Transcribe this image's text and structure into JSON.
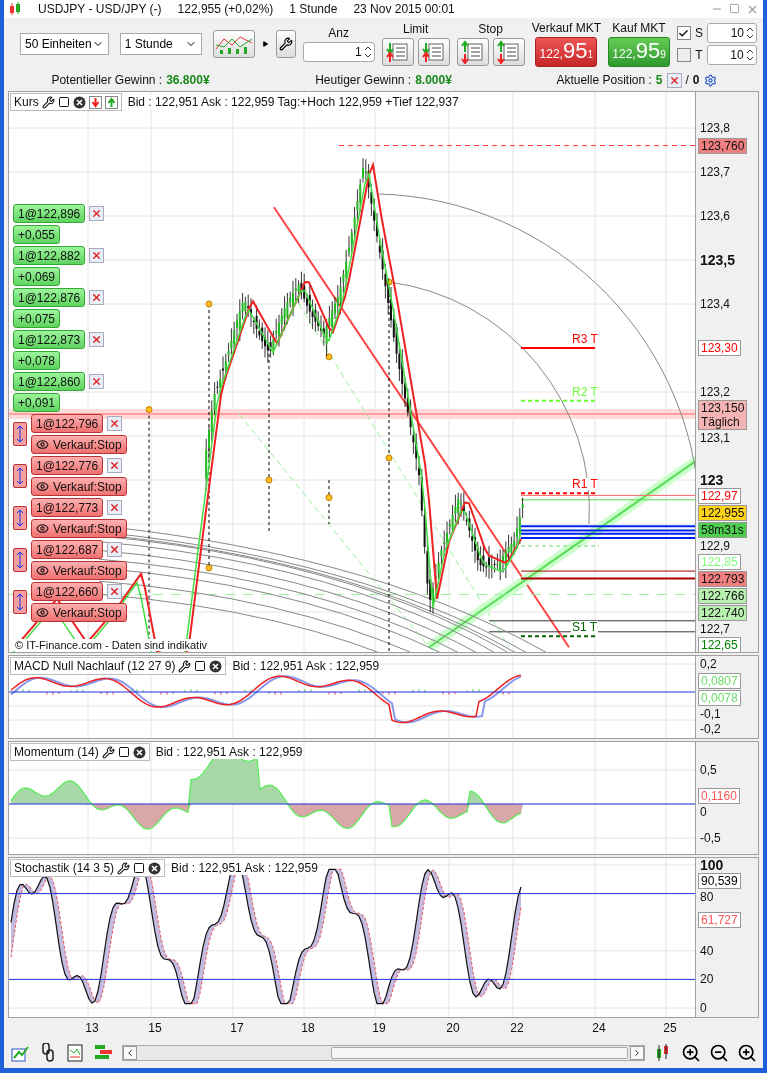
{
  "window": {
    "title": "USDJPY - USD/JPY (-)",
    "quote": "122,955 (+0,02%)",
    "period": "1 Stunde",
    "datetime": "23 Nov 2015 00:01"
  },
  "toolbar": {
    "units": "50 Einheiten",
    "timeframe": "1 Stunde",
    "quantity": {
      "label": "Anz",
      "value": "1"
    },
    "limit_label": "Limit",
    "stop_label": "Stop",
    "trade_buttons": [
      {
        "kind": "sell",
        "label": "Verkauf MKT",
        "small": "122,",
        "big": "95",
        "pip": "1"
      },
      {
        "kind": "buy",
        "label": "Kauf MKT",
        "small": "122,",
        "big": "95",
        "pip": "9"
      }
    ],
    "options": [
      {
        "label": "S",
        "checked": true,
        "value": "10"
      },
      {
        "label": "T",
        "checked": false,
        "value": "10"
      }
    ]
  },
  "summary": [
    {
      "label": "Potentieller Gewinn :",
      "value": "36.800¥"
    },
    {
      "label": "Heutiger Gewinn :",
      "value": "8.000¥"
    }
  ],
  "position": {
    "label": "Aktuelle Position :",
    "long": "5",
    "separator": "/",
    "short": "0"
  },
  "price_panel": {
    "title": "Kurs",
    "quote": "Bid : 122,951 Ask : 122,959 Tag:+Hoch 122,959 +Tief 122,937",
    "copyright": "© IT-Finance.com - Daten sind indikativ",
    "axis": [
      {
        "label": "123,8",
        "kind": "tick"
      },
      {
        "label": "123,760",
        "kind": "filled",
        "color": "#f08080"
      },
      {
        "label": "123,7",
        "kind": "tick"
      },
      {
        "label": "123,6",
        "kind": "tick"
      },
      {
        "label": "123,5",
        "kind": "major"
      },
      {
        "label": "123,4",
        "kind": "tick"
      },
      {
        "label": "123,30",
        "kind": "outlined",
        "color": "#ff0000"
      },
      {
        "label": "123,2",
        "kind": "tick"
      },
      {
        "label": "123,150",
        "sub": "Täglich",
        "kind": "filled",
        "color": "#f4b4b4"
      },
      {
        "label": "123,1",
        "kind": "tick"
      },
      {
        "label": "123",
        "kind": "major"
      },
      {
        "label": "122,97",
        "kind": "outlined",
        "color": "#ff0000"
      },
      {
        "label": "122,955",
        "kind": "filled",
        "color": "#ffd21a"
      },
      {
        "label": "58m31s",
        "kind": "filled",
        "color": "#4fcf4f"
      },
      {
        "label": "122,9",
        "kind": "tick"
      },
      {
        "label": "122,85",
        "kind": "outlined",
        "color": "#7cff7c"
      },
      {
        "label": "122.793",
        "kind": "filled",
        "color": "#f08080"
      },
      {
        "label": "122.766",
        "kind": "filled",
        "color": "#b8f0b0"
      },
      {
        "label": "122.740",
        "kind": "filled",
        "color": "#b8f0b0"
      },
      {
        "label": "122,7",
        "kind": "tick"
      },
      {
        "label": "122,65",
        "kind": "outlined",
        "color": "#008000"
      }
    ],
    "pivot_labels": [
      {
        "label": "R3 T",
        "color": "#ff0000"
      },
      {
        "label": "R2 T",
        "color": "#66ff33"
      },
      {
        "label": "R1 T",
        "color": "#ff0000"
      },
      {
        "label": "S1 T",
        "color": "#006400"
      }
    ],
    "open_positions": [
      {
        "entry": "1@122,896",
        "profit": "+0,055"
      },
      {
        "entry": "1@122,882",
        "profit": "+0,069"
      },
      {
        "entry": "1@122,876",
        "profit": "+0,075"
      },
      {
        "entry": "1@122,873",
        "profit": "+0,078"
      },
      {
        "entry": "1@122,860",
        "profit": "+0,091"
      }
    ],
    "stop_orders": [
      {
        "entry": "1@122,796",
        "action": "Verkauf:Stop"
      },
      {
        "entry": "1@122,776",
        "action": "Verkauf:Stop"
      },
      {
        "entry": "1@122,773",
        "action": "Verkauf:Stop"
      },
      {
        "entry": "1@122,687",
        "action": "Verkauf:Stop"
      },
      {
        "entry": "1@122,660",
        "action": "Verkauf:Stop"
      }
    ]
  },
  "indicators": [
    {
      "kind": "macd",
      "title": "MACD Null Nachlauf (12 27 9)",
      "quote": "Bid : 122,951 Ask : 122,959",
      "axis": [
        {
          "label": "0,2",
          "kind": "tick"
        },
        {
          "label": "0,0807",
          "kind": "outlined",
          "color": "#66dd66"
        },
        {
          "label": "0,0078",
          "kind": "outlined",
          "color": "#66dd66"
        },
        {
          "label": "-0,1",
          "kind": "tick"
        },
        {
          "label": "-0,2",
          "kind": "tick"
        }
      ]
    },
    {
      "kind": "momentum",
      "title": "Momentum (14)",
      "quote": "Bid : 122,951 Ask : 122,959",
      "axis": [
        {
          "label": "0,5",
          "kind": "tick"
        },
        {
          "label": "0,1160",
          "kind": "outlined",
          "color": "#ff5555"
        },
        {
          "label": "0",
          "kind": "tick"
        },
        {
          "label": "-0,5",
          "kind": "tick"
        }
      ]
    },
    {
      "kind": "stochastic",
      "title": "Stochastik (14 3 5)",
      "quote": "Bid : 122,951 Ask : 122,959",
      "axis": [
        {
          "label": "100",
          "kind": "major"
        },
        {
          "label": "90,539",
          "kind": "outlined",
          "color": "#000000"
        },
        {
          "label": "80",
          "kind": "tick"
        },
        {
          "label": "61,727",
          "kind": "outlined",
          "color": "#ff5555"
        },
        {
          "label": "40",
          "kind": "tick"
        },
        {
          "label": "20",
          "kind": "tick"
        },
        {
          "label": "0",
          "kind": "tick"
        }
      ]
    }
  ],
  "x_axis": [
    "13",
    "15",
    "17",
    "18",
    "19",
    "20",
    "22",
    "24",
    "25"
  ]
}
